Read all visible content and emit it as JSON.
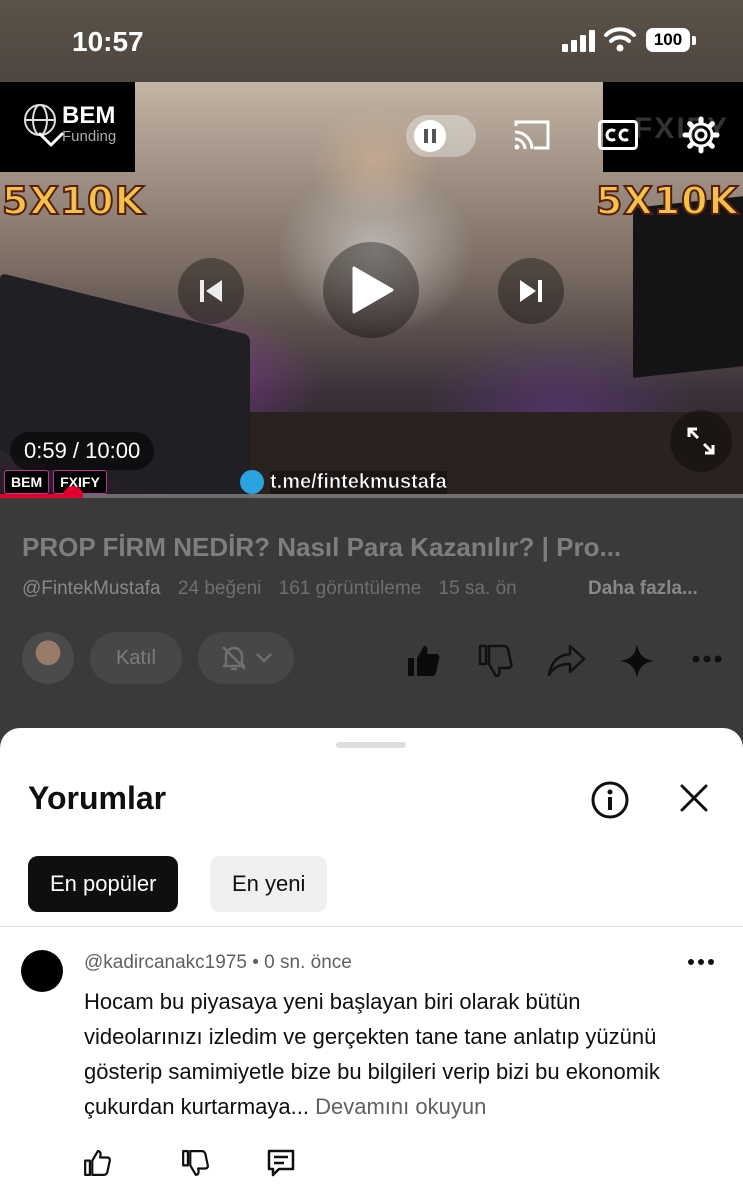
{
  "status_bar": {
    "time": "10:57",
    "battery": "100"
  },
  "video": {
    "brand_left_name": "BEM",
    "brand_left_sub": "Funding",
    "brand_right": "FXIFY",
    "promo_left": "5X10K",
    "promo_right": "5X10K",
    "time_display": "0:59 / 10:00",
    "overlay_logo_1": "BEM",
    "overlay_logo_2": "FXIFY",
    "telegram_link": "t.me/fintekmustafa",
    "progress_fraction": 0.098
  },
  "info": {
    "title": "PROP FİRM NEDİR? Nasıl Para Kazanılır? | Pro...",
    "channel": "@FintekMustafa",
    "likes": "24 beğeni",
    "views": "161 görüntüleme",
    "age": "15 sa. ön",
    "more": "Daha fazla...",
    "join_label": "Katıl"
  },
  "comments": {
    "title": "Yorumlar",
    "chips": [
      "En popüler",
      "En yeni"
    ],
    "items": [
      {
        "author": "@kadircanakc1975",
        "time": "• 0 sn. önce",
        "text": "Hocam bu piyasaya yeni başlayan biri olarak bütün videolarınızı izledim ve gerçekten tane tane anlatıp yüzünü gösterip samimiyetle bize bu bilgileri verip bizi bu ekonomik çukurdan kurtarmaya...",
        "read_more": "Devamını okuyun"
      }
    ]
  },
  "colors": {
    "accent_red": "#e1002d",
    "chip_active": "#0f0f0f",
    "chip_inactive": "#f0f0f0"
  }
}
